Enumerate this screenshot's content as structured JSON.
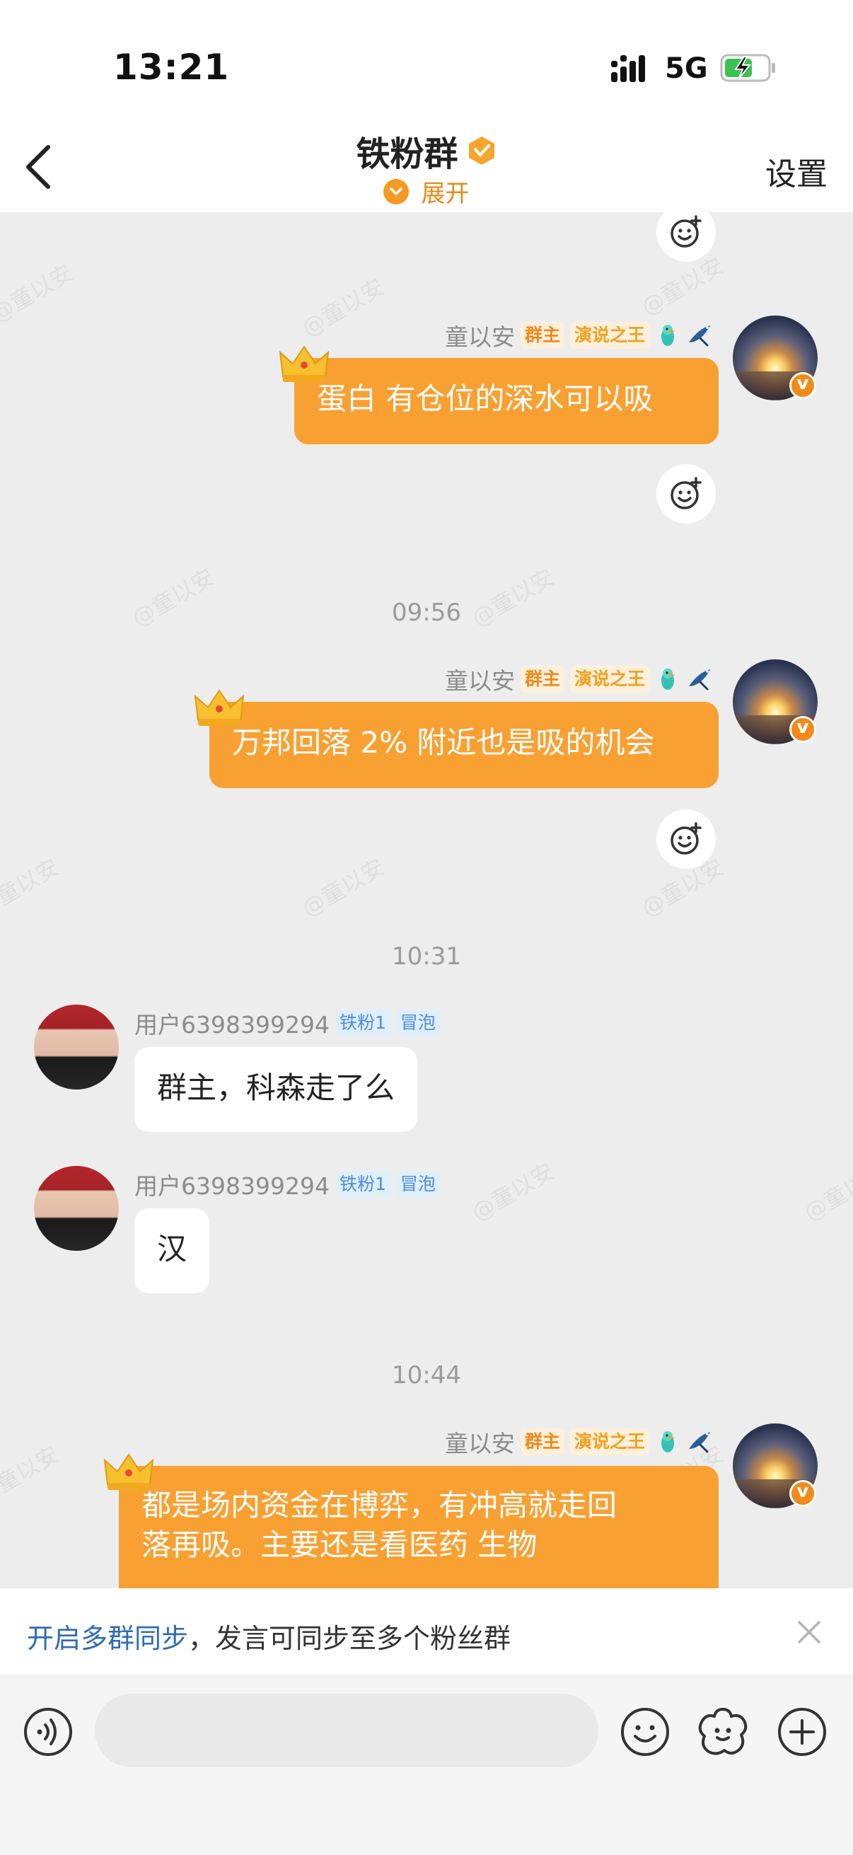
{
  "status_bar": {
    "time": "13:21",
    "network": "5G"
  },
  "nav": {
    "title": "铁粉群",
    "expand_label": "展开",
    "settings_label": "设置"
  },
  "watermark": "@童以安",
  "messages": [
    {
      "sender": "童以安",
      "tags": [
        "群主",
        "演说之王"
      ],
      "text": "蛋白 有仓位的深水可以吸"
    },
    {
      "timestamp": "09:56"
    },
    {
      "sender": "童以安",
      "tags": [
        "群主",
        "演说之王"
      ],
      "text": "万邦回落 2% 附近也是吸的机会"
    },
    {
      "timestamp": "10:31"
    },
    {
      "sender": "用户6398399294",
      "tags": [
        "铁粉1",
        "冒泡"
      ],
      "text": "群主，科森走了么"
    },
    {
      "sender": "用户6398399294",
      "tags": [
        "铁粉1",
        "冒泡"
      ],
      "text": "汉"
    },
    {
      "timestamp": "10:44"
    },
    {
      "sender": "童以安",
      "tags": [
        "群主",
        "演说之王"
      ],
      "text_line1": "都是场内资金在博弈，有冲高就走回",
      "text_line2": "落再吸。主要还是看医药 生物"
    }
  ],
  "sync_tip": {
    "link": "开启多群同步",
    "rest": "，发言可同步至多个粉丝群"
  },
  "input": {
    "placeholder": ""
  },
  "icons": {
    "back": "chevron-left-icon",
    "reaction": "add-emoji-icon",
    "close": "close-icon",
    "voice": "voice-icon",
    "emoji": "emoji-icon",
    "sticker": "sticker-icon",
    "plus": "plus-icon"
  },
  "colors": {
    "accent_orange": "#f9a033",
    "owner_tag": "#f08a1c",
    "fan_tag": "#4a8fdf",
    "link_blue": "#2f6bb8",
    "chat_bg": "#ededed"
  }
}
